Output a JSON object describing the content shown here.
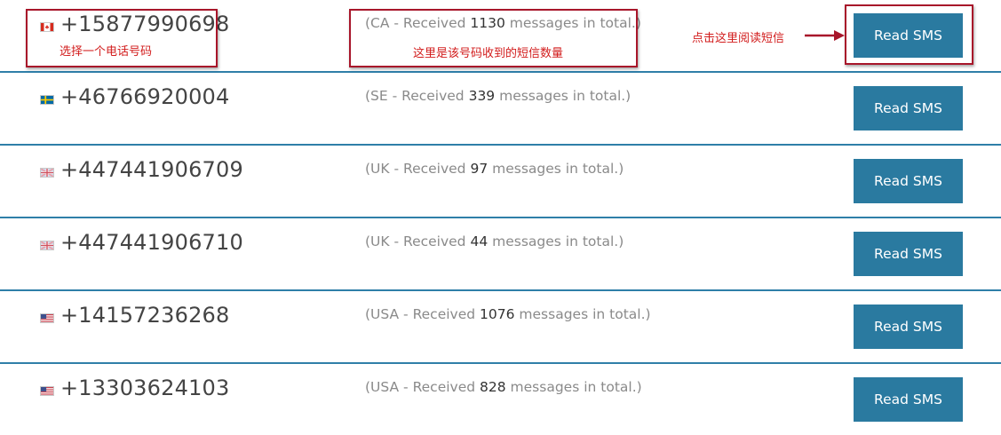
{
  "rows": [
    {
      "flag": "ca-flag-icon",
      "phone": "+15877990698",
      "prefix": "(CA - Received ",
      "count": "1130",
      "suffix": " messages in total.)",
      "button": "Read SMS"
    },
    {
      "flag": "se-flag-icon",
      "phone": "+46766920004",
      "prefix": "(SE - Received ",
      "count": "339",
      "suffix": " messages in total.)",
      "button": "Read SMS"
    },
    {
      "flag": "uk-flag-icon",
      "phone": "+447441906709",
      "prefix": "(UK - Received ",
      "count": "97",
      "suffix": " messages in total.)",
      "button": "Read SMS"
    },
    {
      "flag": "uk-flag-icon",
      "phone": "+447441906710",
      "prefix": "(UK - Received ",
      "count": "44",
      "suffix": " messages in total.)",
      "button": "Read SMS"
    },
    {
      "flag": "us-flag-icon",
      "phone": "+14157236268",
      "prefix": "(USA - Received ",
      "count": "1076",
      "suffix": " messages in total.)",
      "button": "Read SMS"
    },
    {
      "flag": "us-flag-icon",
      "phone": "+13303624103",
      "prefix": "(USA - Received ",
      "count": "828",
      "suffix": " messages in total.)",
      "button": "Read SMS"
    }
  ],
  "annotations": {
    "select_number": "选择一个电话号码",
    "message_count": "这里是该号码收到的短信数量",
    "click_read": "点击这里阅读短信"
  },
  "colors": {
    "row_divider": "#2f7fa8",
    "button": "#2a7aa0",
    "annotation": "#d21c1c"
  }
}
